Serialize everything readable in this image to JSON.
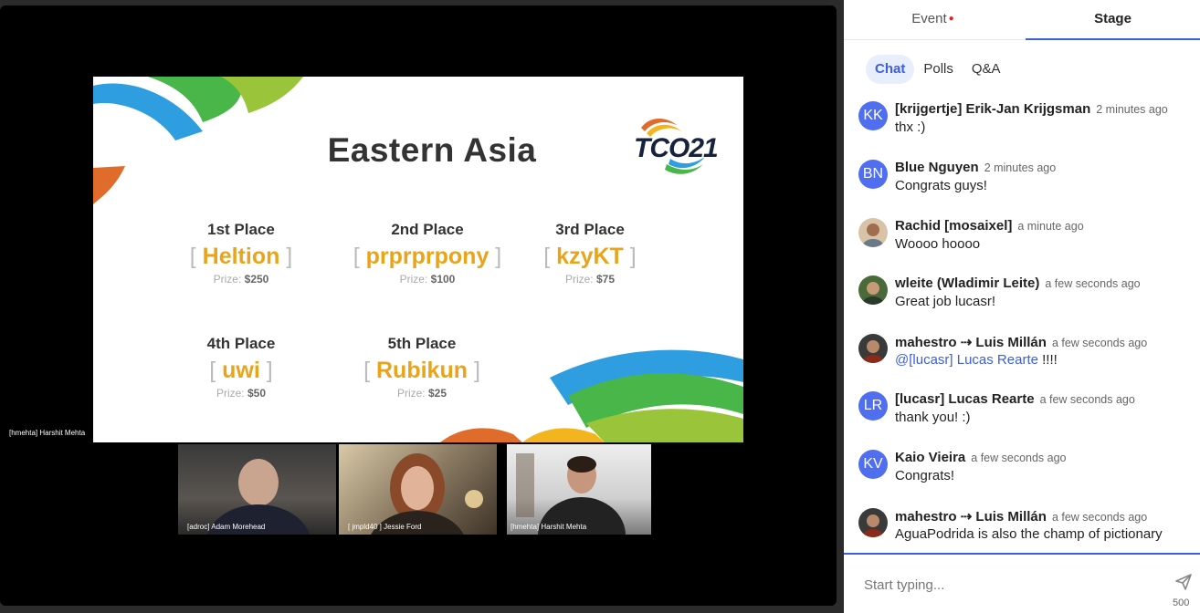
{
  "stage": {
    "slide": {
      "title": "Eastern Asia",
      "logo_text": "TCO21",
      "places": [
        {
          "title": "1st Place",
          "name": "Heltion",
          "prize_label": "Prize:",
          "prize": "$250"
        },
        {
          "title": "2nd Place",
          "name": "prprprpony",
          "prize_label": "Prize:",
          "prize": "$100"
        },
        {
          "title": "3rd Place",
          "name": "kzyKT",
          "prize_label": "Prize:",
          "prize": "$75"
        },
        {
          "title": "4th Place",
          "name": "uwi",
          "prize_label": "Prize:",
          "prize": "$50"
        },
        {
          "title": "5th Place",
          "name": "Rubikun",
          "prize_label": "Prize:",
          "prize": "$25"
        }
      ]
    },
    "screen_share_tag": "[hmehta] Harshit Mehta",
    "participants": [
      {
        "name": "[adroc] Adam Morehead"
      },
      {
        "name": "[ jmpld40 ] Jessie Ford"
      },
      {
        "name": "[hmehta] Harshit Mehta"
      }
    ]
  },
  "panel": {
    "tabs": [
      {
        "label": "Event",
        "has_dot": true
      },
      {
        "label": "Stage",
        "active": true
      }
    ],
    "sub_tabs": [
      {
        "label": "Chat",
        "active": true
      },
      {
        "label": "Polls"
      },
      {
        "label": "Q&A"
      }
    ],
    "messages": [
      {
        "initials": "KK",
        "author": "[krijgertje] Erik-Jan Krijgsman",
        "time": "2 minutes ago",
        "text": "thx :)"
      },
      {
        "initials": "BN",
        "author": "Blue Nguyen",
        "time": "2 minutes ago",
        "text": "Congrats guys!"
      },
      {
        "initials": "",
        "author": "Rachid [mosaixel]",
        "time": "a minute ago",
        "text": "Woooo hoooo"
      },
      {
        "initials": "",
        "author": "wleite (Wladimir Leite)",
        "time": "a few seconds ago",
        "text": "Great job lucasr!"
      },
      {
        "initials": "",
        "author": "mahestro ⇢ Luis Millán",
        "time": "a few seconds ago",
        "mention": "@[lucasr] Lucas Rearte",
        "text": " !!!!"
      },
      {
        "initials": "LR",
        "author": "[lucasr] Lucas Rearte",
        "time": "a few seconds ago",
        "text": "thank you! :)"
      },
      {
        "initials": "KV",
        "author": "Kaio Vieira",
        "time": "a few seconds ago",
        "text": "Congrats!"
      },
      {
        "initials": "",
        "author": "mahestro ⇢ Luis Millán",
        "time": "a few seconds ago",
        "text": "AguaPodrida is also the champ of pictionary"
      }
    ],
    "composer": {
      "placeholder": "Start typing...",
      "char_count": "500"
    }
  },
  "colors": {
    "accent": "#3c5ee0",
    "avatar_bg": "#4f6ef0",
    "gold": "#e9a41a"
  }
}
